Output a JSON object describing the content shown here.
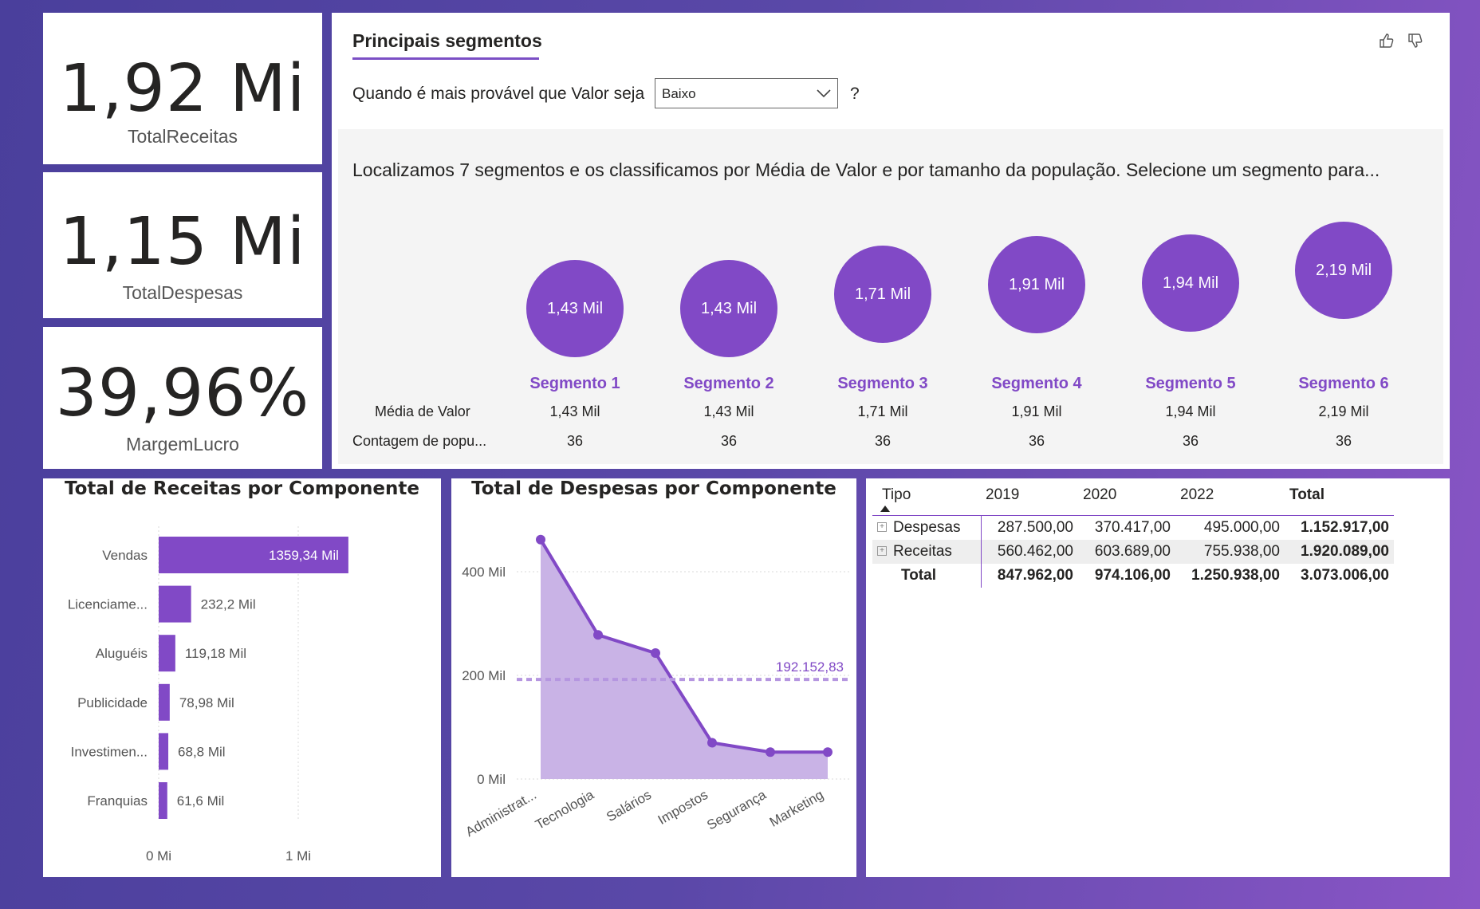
{
  "kpis": [
    {
      "value": "1,92 Mi",
      "label": "TotalReceitas"
    },
    {
      "value": "1,15 Mi",
      "label": "TotalDespesas"
    },
    {
      "value": "39,96%",
      "label": "MargemLucro"
    }
  ],
  "segments_panel": {
    "title": "Principais segmentos",
    "question_prefix": "Quando é mais provável que Valor seja",
    "dropdown_value": "Baixo",
    "question_suffix": "?",
    "summary": "Localizamos 7 segmentos e os classificamos por Média de Valor e por tamanho da população. Selecione um segmento para...",
    "row_labels": [
      "Média de Valor",
      "Contagem de popu..."
    ],
    "segments": [
      {
        "name": "Segmento 1",
        "circle": "1,43 Mil",
        "media": "1,43 Mil",
        "contagem": "36"
      },
      {
        "name": "Segmento 2",
        "circle": "1,43 Mil",
        "media": "1,43 Mil",
        "contagem": "36"
      },
      {
        "name": "Segmento 3",
        "circle": "1,71 Mil",
        "media": "1,71 Mil",
        "contagem": "36"
      },
      {
        "name": "Segmento 4",
        "circle": "1,91 Mil",
        "media": "1,91 Mil",
        "contagem": "36"
      },
      {
        "name": "Segmento 5",
        "circle": "1,94 Mil",
        "media": "1,94 Mil",
        "contagem": "36"
      },
      {
        "name": "Segmento 6",
        "circle": "2,19 Mil",
        "media": "2,19 Mil",
        "contagem": "36"
      }
    ],
    "icons": [
      "thumbs-up-icon",
      "thumbs-down-icon"
    ]
  },
  "chart_data": [
    {
      "type": "bar",
      "orientation": "horizontal",
      "title": "Total de Receitas por Componente",
      "categories": [
        "Vendas",
        "Licenciame...",
        "Aluguéis",
        "Publicidade",
        "Investimen...",
        "Franquias"
      ],
      "values": [
        1359.34,
        232.2,
        119.18,
        78.98,
        68.8,
        61.6
      ],
      "value_labels": [
        "1359,34 Mil",
        "232,2 Mil",
        "119,18 Mil",
        "78,98 Mil",
        "68,8 Mil",
        "61,6 Mil"
      ],
      "xticks": [
        "0 Mi",
        "1 Mi"
      ],
      "xlim": [
        0,
        1300
      ],
      "color": "#8149c6"
    },
    {
      "type": "area",
      "title": "Total de Despesas por Componente",
      "categories": [
        "Administrat...",
        "Tecnologia",
        "Salários",
        "Impostos",
        "Segurança",
        "Marketing"
      ],
      "values": [
        462,
        278,
        243,
        70,
        52,
        52
      ],
      "yticks": [
        "0 Mil",
        "200 Mil",
        "400 Mil"
      ],
      "ylim": [
        0,
        460
      ],
      "average_line": 192.15283,
      "average_label": "192.152,83",
      "color": "#8149c6"
    }
  ],
  "matrix": {
    "headers": [
      "Tipo",
      "2019",
      "2020",
      "2022",
      "Total"
    ],
    "rows": [
      {
        "tipo": "Despesas",
        "v2019": "287.500,00",
        "v2020": "370.417,00",
        "v2022": "495.000,00",
        "total": "1.152.917,00"
      },
      {
        "tipo": "Receitas",
        "v2019": "560.462,00",
        "v2020": "603.689,00",
        "v2022": "755.938,00",
        "total": "1.920.089,00"
      }
    ],
    "total_row": {
      "tipo": "Total",
      "v2019": "847.962,00",
      "v2020": "974.106,00",
      "v2022": "1.250.938,00",
      "total": "3.073.006,00"
    }
  }
}
